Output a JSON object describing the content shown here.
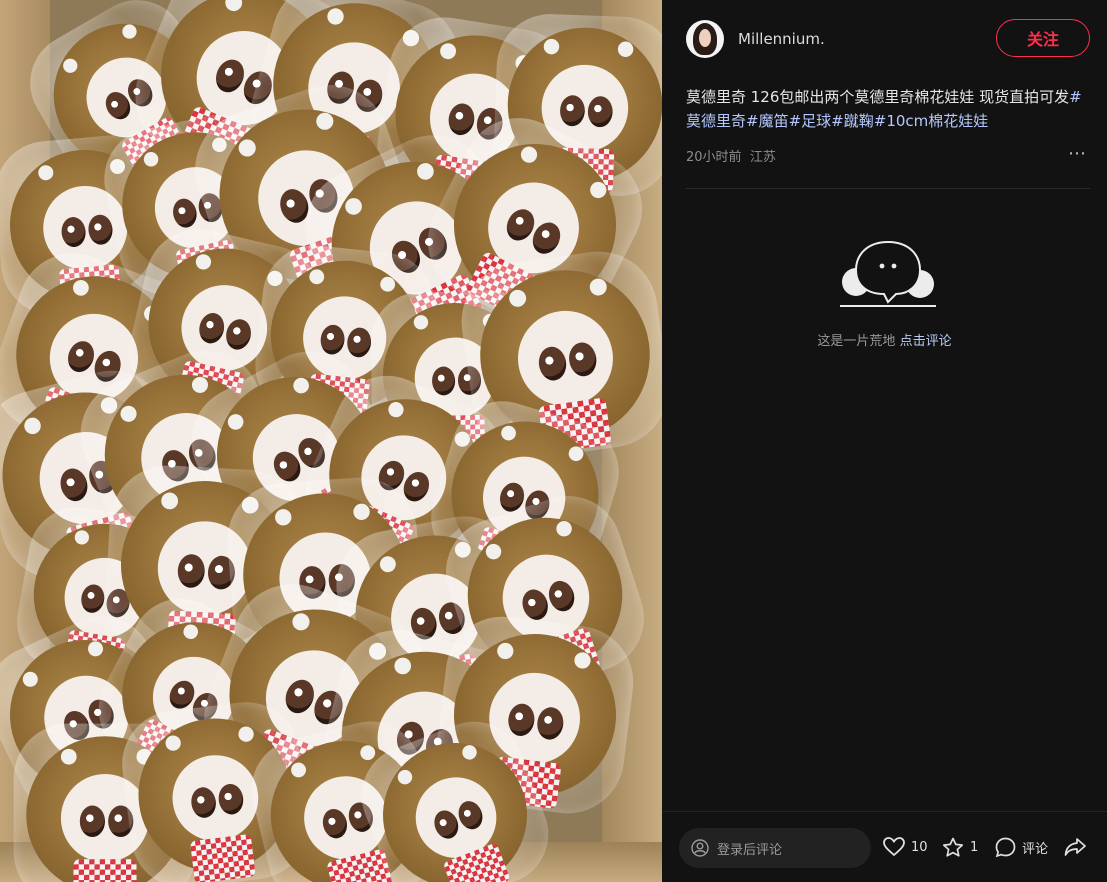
{
  "author": {
    "name": "Millennium.",
    "follow_label": "关注"
  },
  "post": {
    "line1_text": "莫德里奇  126包邮出两个莫德里奇棉花娃娃 现货直拍可发",
    "tags": [
      "#莫德里奇",
      "#魔笛",
      "#足球",
      "#蹴鞠",
      "#10cm棉花娃娃"
    ],
    "time": "20小时前",
    "location": "江苏",
    "more": "⋯"
  },
  "comments": {
    "empty_text": "这是一片荒地",
    "empty_link": "点击评论"
  },
  "bottom": {
    "input_placeholder": "登录后评论",
    "like_count": "10",
    "collect_count": "1",
    "comment_label": "评论"
  },
  "colors": {
    "accent": "#ff2e4d",
    "panel_bg": "#121212",
    "tag_color": "#b4c8ff"
  },
  "icons": [
    "user-icon",
    "heart-icon",
    "star-icon",
    "comment-icon",
    "share-icon",
    "empty-comment-icon"
  ]
}
